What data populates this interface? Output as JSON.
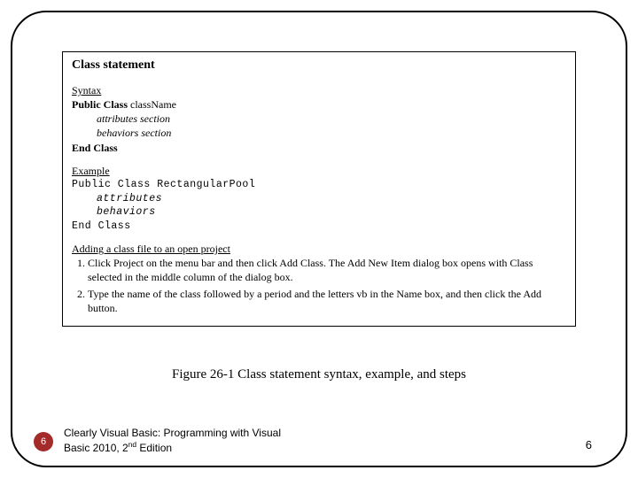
{
  "box": {
    "title": "Class statement",
    "syntax_heading": "Syntax",
    "syntax_line1_bold": "Public Class",
    "syntax_line1_rest": " className",
    "syntax_attr": "attributes section",
    "syntax_behav": "behaviors section",
    "syntax_end": "End Class",
    "example_heading": "Example",
    "ex_line1": "Public Class RectangularPool",
    "ex_attr": "attributes",
    "ex_behav": "behaviors",
    "ex_end": "End Class",
    "adding_heading": "Adding a class file to an open project",
    "step1": "Click Project on the menu bar and then click Add Class. The Add New Item dialog box opens with Class selected in the middle column of the dialog box.",
    "step2": "Type the name of the class followed by a period and the letters vb in the Name box, and then click the Add button."
  },
  "caption": "Figure 26-1 Class statement syntax, example, and steps",
  "footer": {
    "badge": "6",
    "text_line1": "Clearly Visual Basic: Programming with Visual",
    "text_line2_a": "Basic 2010, 2",
    "text_line2_sup": "nd",
    "text_line2_b": " Edition",
    "page_right": "6"
  }
}
